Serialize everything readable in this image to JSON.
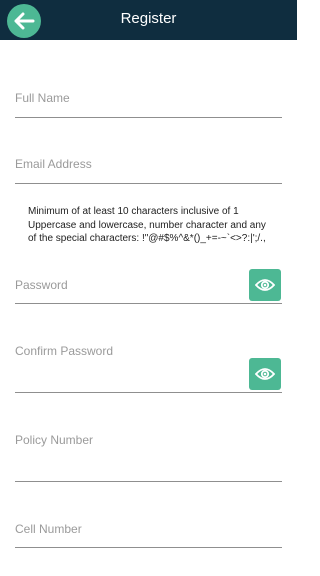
{
  "header": {
    "title": "Register",
    "back_icon": "arrow-left-icon"
  },
  "form": {
    "full_name_placeholder": "Full Name",
    "email_placeholder": "Email Address",
    "password_hint": "Minimum of at least 10 characters inclusive of 1 Uppercase and lowercase, number character and any of the special characters: !\"@#$%^&*()_+=-~`<>?:|';/.,",
    "password_placeholder": "Password",
    "confirm_password_placeholder": "Confirm Password",
    "policy_number_placeholder": "Policy Number",
    "cell_number_placeholder": "Cell Number",
    "show_password_icon": "eye-icon"
  },
  "colors": {
    "header_bg": "#0f2d3f",
    "accent": "#4db894",
    "placeholder": "#9a9a9a",
    "underline": "#8f8f8f"
  }
}
